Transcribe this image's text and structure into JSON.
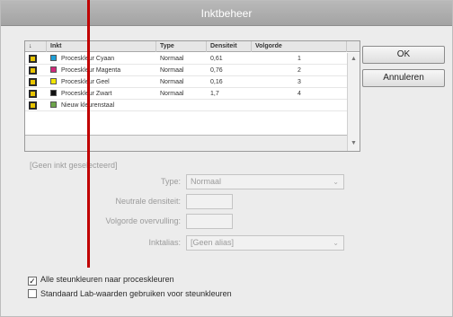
{
  "window": {
    "title": "Inktbeheer"
  },
  "table": {
    "columns": [
      "Inkt",
      "Type",
      "Densiteit",
      "Volgorde"
    ],
    "rows": [
      {
        "name": "Proceskleur Cyaan",
        "type": "Normaal",
        "density": "0,61",
        "order": "1",
        "color": "#1e9fd6"
      },
      {
        "name": "Proceskleur Magenta",
        "type": "Normaal",
        "density": "0,76",
        "order": "2",
        "color": "#d1287a"
      },
      {
        "name": "Proceskleur Geel",
        "type": "Normaal",
        "density": "0,16",
        "order": "3",
        "color": "#f2e600"
      },
      {
        "name": "Proceskleur Zwart",
        "type": "Normaal",
        "density": "1,7",
        "order": "4",
        "color": "#111111"
      },
      {
        "name": "Nieuw kleurenstaal",
        "type": "",
        "density": "",
        "order": "",
        "color": "#6ea64b"
      }
    ]
  },
  "buttons": {
    "ok": "OK",
    "cancel": "Annuleren"
  },
  "selection_label": "[Geen inkt geselecteerd]",
  "fields": {
    "type_label": "Type:",
    "type_value": "Normaal",
    "density_label": "Neutrale densiteit:",
    "order_label": "Volgorde overvulling:",
    "alias_label": "Inktalias:",
    "alias_value": "[Geen alias]"
  },
  "checkboxes": {
    "all_process": {
      "label": "Alle steunkleuren naar proceskleuren",
      "checked": true
    },
    "lab_values": {
      "label": "Standaard Lab-waarden gebruiken voor steunkleuren",
      "checked": false
    }
  },
  "colors": {
    "annotation_line": "#c00000"
  }
}
